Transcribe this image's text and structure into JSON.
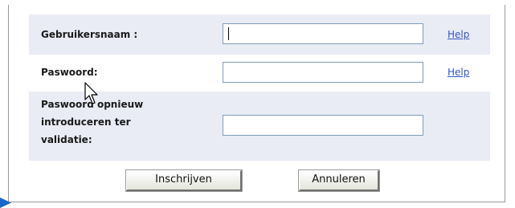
{
  "form": {
    "username": {
      "label": "Gebruikersnaam :",
      "value": "",
      "help": "Help"
    },
    "password": {
      "label": "Paswoord:",
      "value": "",
      "help": "Help"
    },
    "password_confirm": {
      "label": "Paswoord opnieuw introduceren ter validatie:",
      "value": ""
    }
  },
  "buttons": {
    "signup": "Inschrijven",
    "cancel": "Annuleren"
  },
  "colors": {
    "row_shade": "#e9ebf5",
    "link": "#3355cc",
    "input_border": "#7f9db9",
    "corner_arrow": "#1a66cc"
  },
  "icons": {
    "pointer": "mouse-pointer-icon",
    "corner": "play-arrow-icon"
  }
}
